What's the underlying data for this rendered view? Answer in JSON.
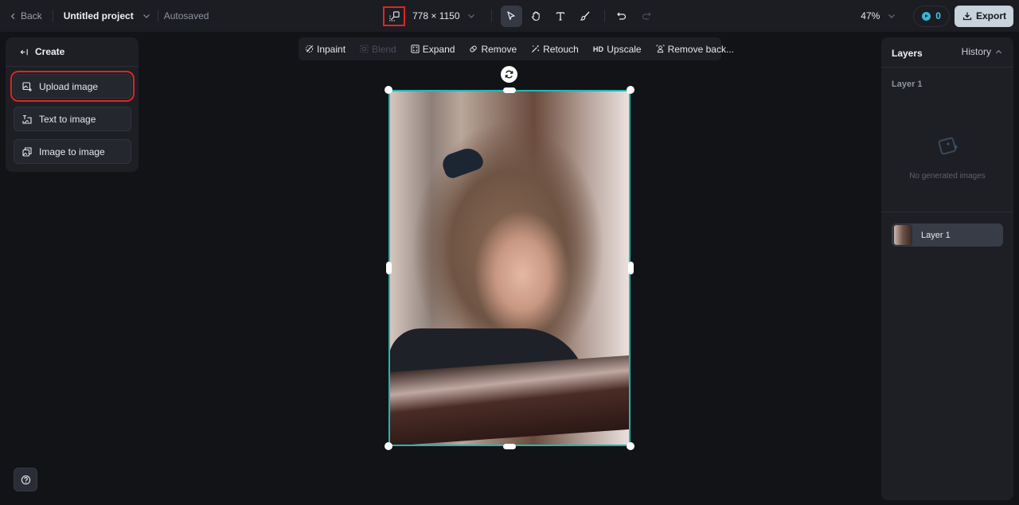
{
  "topbar": {
    "back_label": "Back",
    "project_name": "Untitled project",
    "save_status": "Autosaved",
    "canvas_size": "778 × 1150",
    "zoom_level": "47%",
    "credits": "0",
    "export_label": "Export",
    "tools": [
      {
        "name": "select",
        "icon": "cursor-icon",
        "active": true
      },
      {
        "name": "hand",
        "icon": "hand-icon",
        "active": false
      },
      {
        "name": "text",
        "icon": "text-icon",
        "active": false
      },
      {
        "name": "brush",
        "icon": "brush-icon",
        "active": false
      }
    ]
  },
  "create_panel": {
    "title": "Create",
    "items": [
      {
        "label": "Upload image",
        "highlighted": true
      },
      {
        "label": "Text to image",
        "highlighted": false
      },
      {
        "label": "Image to image",
        "highlighted": false
      }
    ]
  },
  "edit_toolbar": {
    "items": [
      {
        "label": "Inpaint",
        "enabled": true
      },
      {
        "label": "Blend",
        "enabled": false
      },
      {
        "label": "Expand",
        "enabled": true
      },
      {
        "label": "Remove",
        "enabled": true
      },
      {
        "label": "Retouch",
        "enabled": true
      },
      {
        "label": "Upscale",
        "enabled": true,
        "badge": "HD"
      },
      {
        "label": "Remove back...",
        "enabled": true
      }
    ]
  },
  "layers_panel": {
    "title": "Layers",
    "history_label": "History",
    "current_layer_label": "Layer 1",
    "empty_text": "No generated images",
    "layers": [
      {
        "name": "Layer 1"
      }
    ]
  },
  "colors": {
    "selection": "#1fb8b4",
    "highlight": "#e02424",
    "accent": "#38b5d6"
  }
}
